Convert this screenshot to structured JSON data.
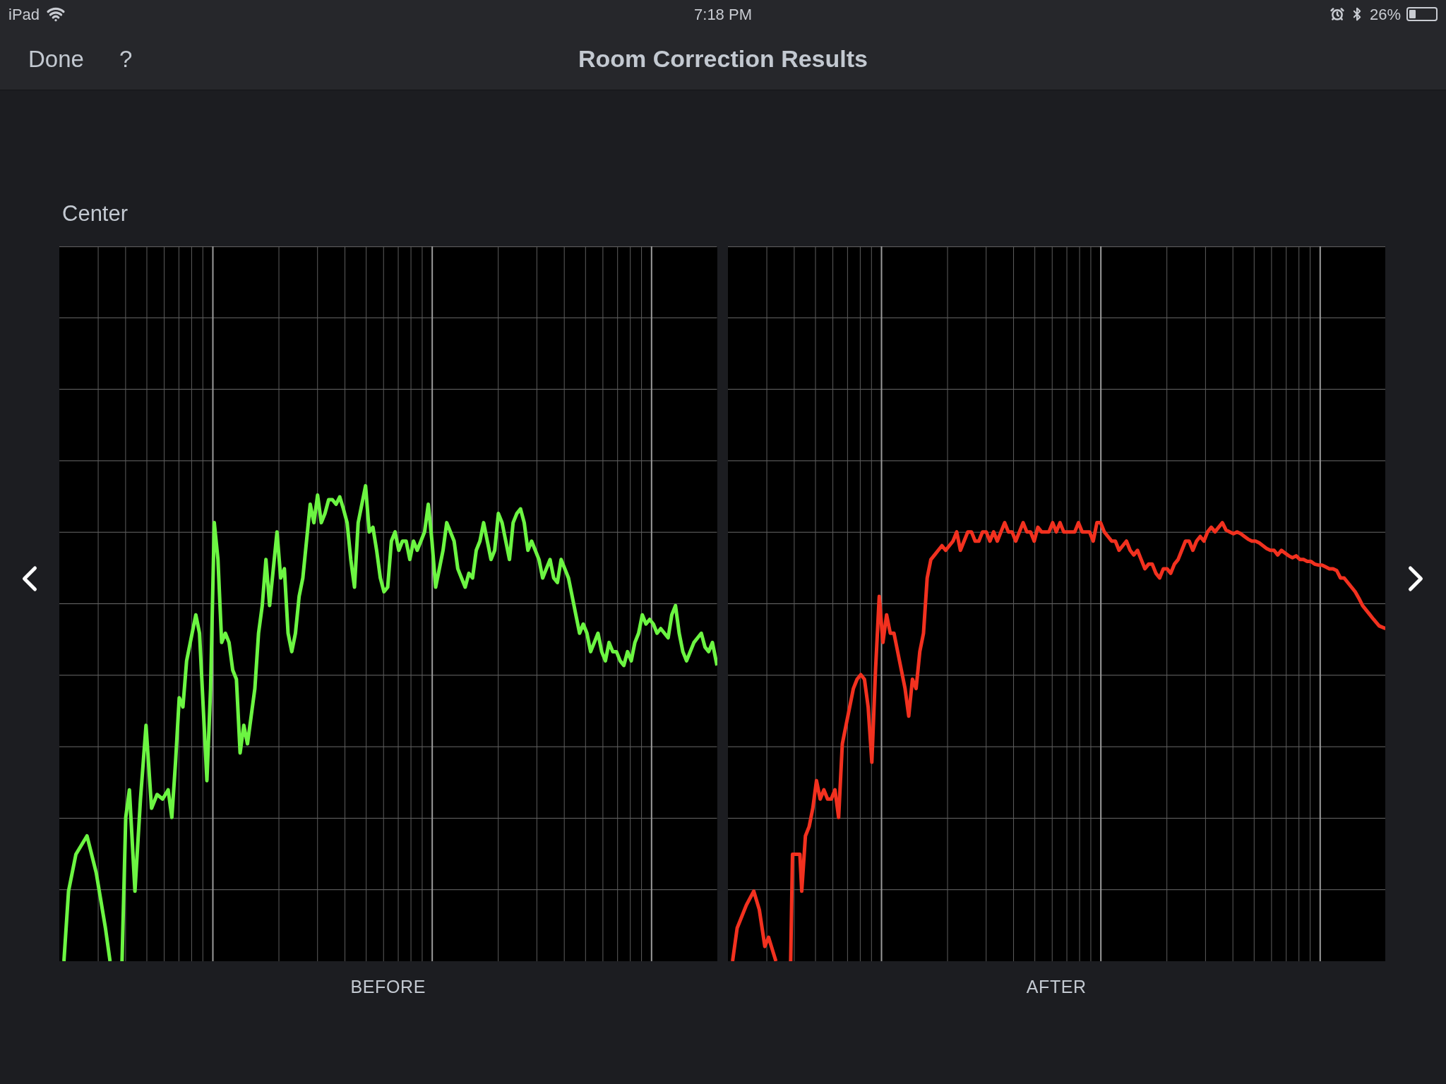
{
  "status_bar": {
    "device": "iPad",
    "time": "7:18 PM",
    "battery": "26%"
  },
  "nav": {
    "done": "Done",
    "help": "?",
    "title": "Room Correction Results"
  },
  "channel": "Center",
  "graphs": [
    {
      "label": "BEFORE",
      "color": "#6cf542"
    },
    {
      "label": "AFTER",
      "color": "#f2311f"
    }
  ]
}
